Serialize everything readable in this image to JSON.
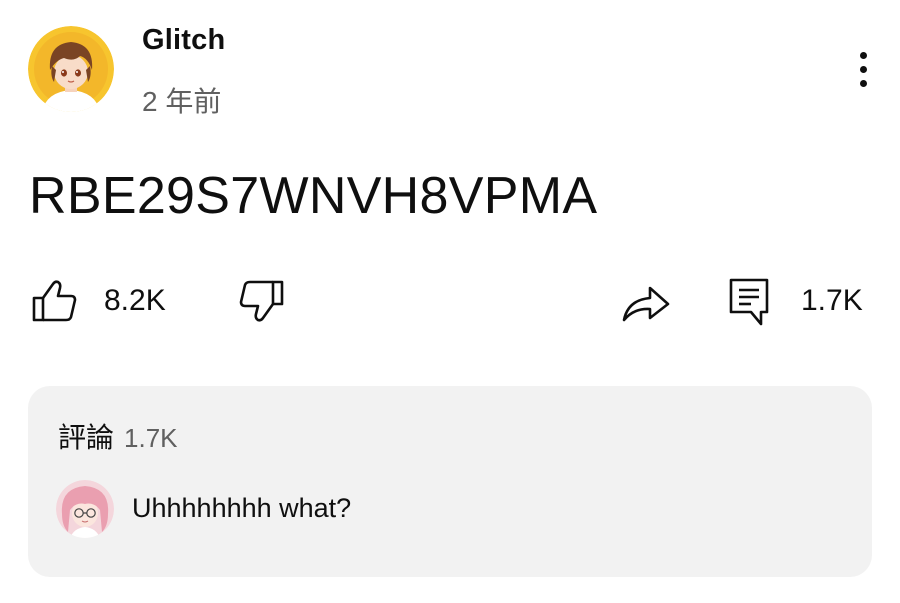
{
  "post": {
    "channel_name": "Glitch",
    "time_ago": "2 年前",
    "text": "RBE29S7WNVH8VPMA"
  },
  "actions": {
    "likes": "8.2K",
    "comments_count": "1.7K"
  },
  "comments": {
    "title": "評論",
    "count": "1.7K",
    "top_comment": "Uhhhhhhhh what?"
  },
  "icons": {
    "like": "thumbs-up-icon",
    "dislike": "thumbs-down-icon",
    "share": "share-arrow-icon",
    "comments": "comment-icon",
    "more": "three-dots-vertical-icon"
  },
  "colors": {
    "text": "#0f0f0f",
    "secondary_text": "#606060",
    "panel_background": "#f2f2f2"
  }
}
